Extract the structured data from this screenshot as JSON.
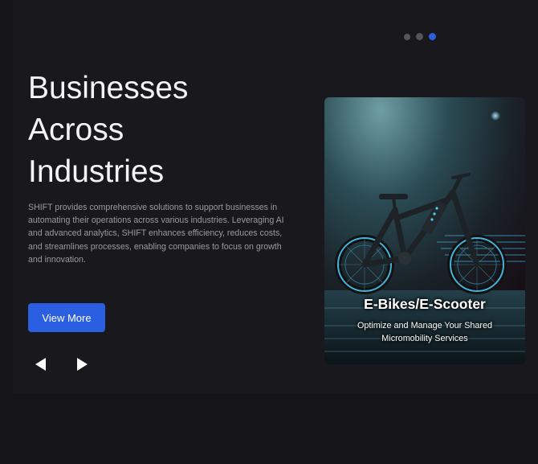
{
  "carousel": {
    "indicators": [
      {
        "active": false
      },
      {
        "active": false
      },
      {
        "active": true
      }
    ],
    "accent_color": "#2b5fe1"
  },
  "hero": {
    "title_lines": [
      "Businesses",
      "Across",
      "Industries"
    ],
    "description": "SHIFT provides comprehensive solutions to support businesses in automating their operations across various industries. Leveraging AI and advanced analytics, SHIFT enhances efficiency, reduces costs, and streamlines processes, enabling companies to focus on growth and innovation.",
    "button_label": "View More",
    "prev_icon": "triangle-left-icon",
    "next_icon": "triangle-right-icon"
  },
  "card": {
    "title": "E-Bikes/E-Scooter",
    "subtitle": "Optimize and Manage Your Shared Micromobility Services",
    "image_subject": "e-bike"
  }
}
